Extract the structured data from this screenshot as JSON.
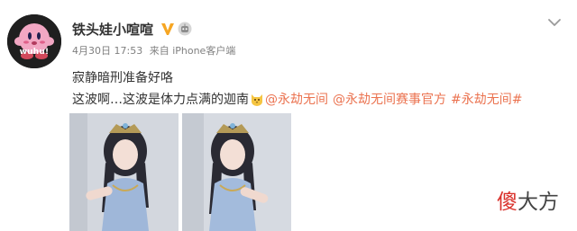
{
  "post": {
    "avatar_caption": "wuhu!",
    "username": "铁头娃小喧喧",
    "date": "4月30日 17:53",
    "source": "来自 iPhone客户端",
    "line1": "寂静暗刑准备好咯",
    "line2_text": "这波啊…这波是体力点满的迦南",
    "hashtags": [
      "@永劫无间",
      "@永劫无间赛事官方",
      "#永劫无间#"
    ]
  },
  "watermark": {
    "part1": "傻",
    "part2": "大方"
  },
  "colors": {
    "link": "#eb7350",
    "badge": "#f6a623",
    "text": "#333333",
    "meta": "#808080"
  },
  "icons": {
    "verified": "v-verified-icon",
    "robot": "robot-badge-icon",
    "menu": "chevron-down-icon",
    "emoji": "cat-face-emoji-icon"
  }
}
